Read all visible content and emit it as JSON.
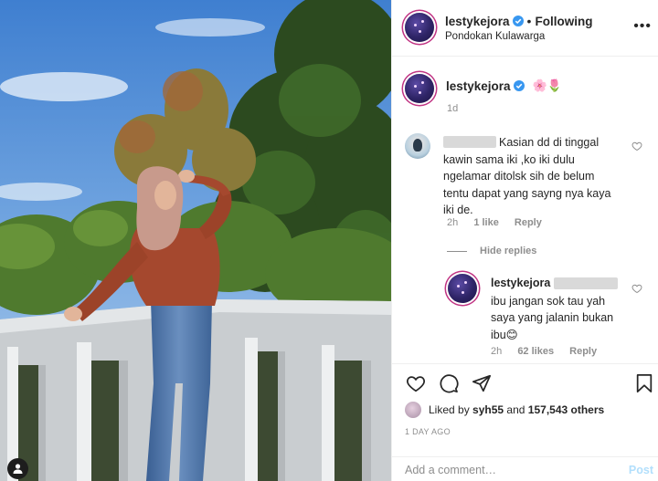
{
  "post": {
    "username": "lestykejora",
    "follow_status": "Following",
    "dot": "•",
    "location": "Pondokan Kulawarga",
    "more_menu": "•••"
  },
  "caption": {
    "username": "lestykejora",
    "emoji": "🌸🌷",
    "age": "1d"
  },
  "comment": {
    "text_lines": [
      "Kasian dd di tinggal",
      "kawin sama iki ,ko iki dulu",
      "ngelamar ditolsk sih de belum",
      "tentu dapat yang sayng nya kaya",
      "iki de."
    ],
    "time": "2h",
    "likes": "1 like",
    "reply": "Reply"
  },
  "hide_replies": "Hide replies",
  "reply": {
    "username": "lestykejora",
    "text_lines": [
      "ibu jangan sok tau yah",
      "saya yang jalanin bukan",
      "ibu😊"
    ],
    "time": "2h",
    "likes": "62 likes",
    "reply": "Reply"
  },
  "likes": {
    "prefix": "Liked by",
    "user": "syh55",
    "middle": "and",
    "count": "157,543 others"
  },
  "posted": "1 DAY AGO",
  "add_comment": {
    "placeholder": "Add a comment…",
    "post_label": "Post"
  },
  "colors": {
    "verified": "#3897f0",
    "secondary_text": "#8e8e8e",
    "post_button": "#b2dffc",
    "story_ring": "#c13584"
  },
  "icons": [
    "verified-badge-icon",
    "heart-icon",
    "comment-icon",
    "share-icon",
    "bookmark-icon",
    "user-tag-icon",
    "more-options-icon"
  ]
}
